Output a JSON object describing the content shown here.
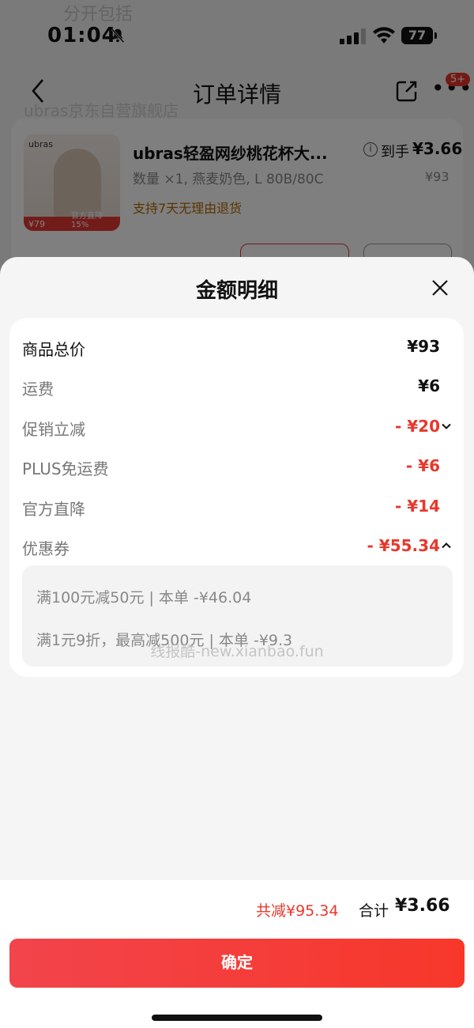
{
  "status_bar": {
    "time": "01:04",
    "battery": "77"
  },
  "background": {
    "ghost_top": "分开包括",
    "nav": {
      "title": "订单详情",
      "badge": "5+"
    },
    "ghost_store": "ubras京东自营旗舰店",
    "product": {
      "image_brand": "ubras",
      "image_price": "¥79",
      "image_label": "官方直降15%",
      "title": "ubras轻盈网纱桃花杯大...",
      "price_label": "到手",
      "price_value": "¥3.66",
      "spec": "数量 ×1, 燕麦奶色, L 80B/80C",
      "orig_price": "¥93",
      "return_policy": "支持7天无理由退货"
    }
  },
  "sheet": {
    "title": "金额明细",
    "rows": [
      {
        "label": "商品总价",
        "value": "¥93"
      },
      {
        "label": "运费",
        "value": "¥6"
      },
      {
        "label": "促销立减",
        "value": "- ¥20"
      },
      {
        "label": "PLUS免运费",
        "value": "- ¥6"
      },
      {
        "label": "官方直降",
        "value": "- ¥14"
      },
      {
        "label": "优惠券",
        "value": "- ¥55.34"
      }
    ],
    "coupons": [
      "满100元减50元 | 本单 -¥46.04",
      "满1元9折，最高减500元 | 本单 -¥9.3"
    ],
    "watermark": "线报酷-new.xianbao.fun",
    "total_reduce": "共减¥95.34",
    "total_label": "合计",
    "total_value": "¥3.66",
    "confirm_label": "确定"
  },
  "colors": {
    "accent_red": "#e8382c",
    "confirm_gradient_start": "#f2444c",
    "confirm_gradient_end": "#f7372a"
  },
  "icons": [
    "bell-muted-icon",
    "signal-icon",
    "wifi-icon",
    "back-icon",
    "share-icon",
    "more-icon",
    "info-icon",
    "close-icon",
    "chevron-down-icon",
    "chevron-up-icon"
  ]
}
